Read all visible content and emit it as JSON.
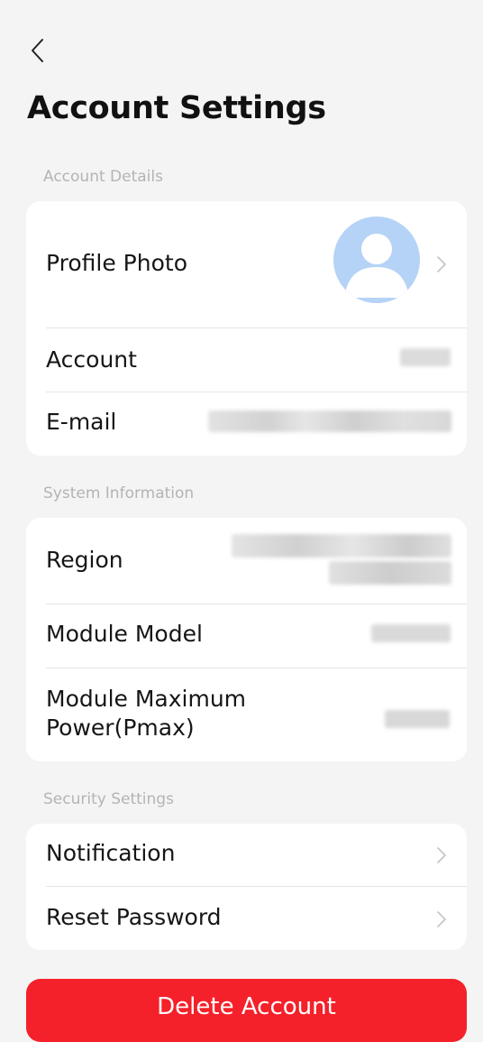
{
  "header": {
    "back_icon": "chevron-left-icon",
    "title": "Account Settings"
  },
  "sections": {
    "account_details": {
      "label": "Account Details",
      "profile_photo": "Profile Photo",
      "account": "Account",
      "email": "E-mail"
    },
    "system_information": {
      "label": "System Information",
      "region": "Region",
      "module_model": "Module Model",
      "module_max_power_line1": "Module Maximum",
      "module_max_power_line2": "Power(Pmax)"
    },
    "security_settings": {
      "label": "Security Settings",
      "notification": "Notification",
      "reset_password": "Reset Password"
    }
  },
  "actions": {
    "delete_account": "Delete Account"
  },
  "colors": {
    "background": "#f4f4f4",
    "card": "#ffffff",
    "section_label": "#b4b4b4",
    "avatar_bg": "#b5d3f7",
    "danger": "#f4212a"
  }
}
